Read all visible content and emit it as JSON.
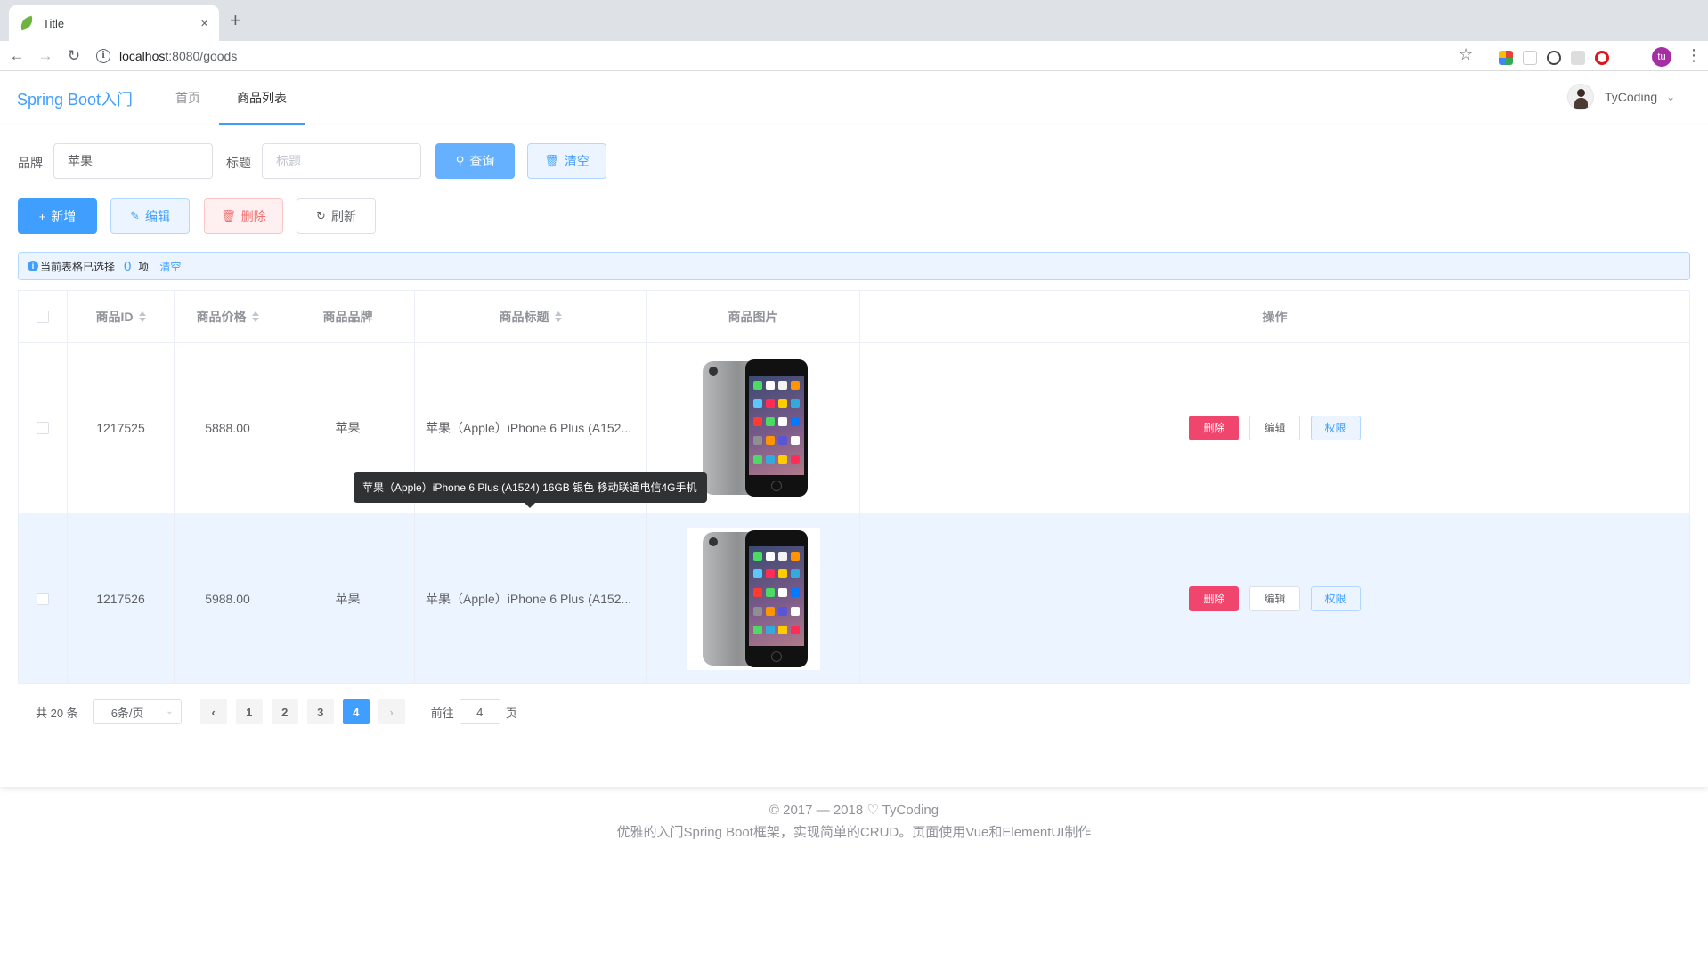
{
  "browser": {
    "tab_title": "Title",
    "tab_close": "×",
    "new_tab": "+",
    "url_host": "localhost",
    "url_path": ":8080/goods",
    "avatar_initials": "tu"
  },
  "header": {
    "brand": "Spring Boot入门",
    "menu": [
      {
        "label": "首页"
      },
      {
        "label": "商品列表"
      }
    ],
    "user_name": "TyCoding"
  },
  "search": {
    "brand_label": "品牌",
    "brand_value": "苹果",
    "title_label": "标题",
    "title_placeholder": "标题",
    "query_label": "查询",
    "clear_label": "清空"
  },
  "actions": {
    "add_label": "新增",
    "edit_label": "编辑",
    "delete_label": "删除",
    "refresh_label": "刷新"
  },
  "alert": {
    "prefix": "当前表格已选择",
    "count": "0",
    "unit": "项",
    "clear": "清空"
  },
  "table": {
    "columns": [
      "商品ID",
      "商品价格",
      "商品品牌",
      "商品标题",
      "商品图片",
      "操作"
    ],
    "rows": [
      {
        "id": "1217525",
        "price": "5888.00",
        "brand": "苹果",
        "title": "苹果（Apple）iPhone 6 Plus (A152..."
      },
      {
        "id": "1217526",
        "price": "5988.00",
        "brand": "苹果",
        "title": "苹果（Apple）iPhone 6 Plus (A152..."
      }
    ],
    "row_actions": {
      "delete": "删除",
      "edit": "编辑",
      "perm": "权限"
    },
    "tooltip": "苹果（Apple）iPhone 6 Plus (A1524) 16GB 银色 移动联通电信4G手机"
  },
  "pagination": {
    "total": "共 20 条",
    "page_size": "6条/页",
    "pages": [
      "1",
      "2",
      "3",
      "4"
    ],
    "current_page": 4,
    "goto_prefix": "前往",
    "goto_value": "4",
    "goto_suffix": "页"
  },
  "footer": {
    "line1": "© 2017 — 2018 ♡ TyCoding",
    "line2": "优雅的入门Spring Boot框架，实现简单的CRUD。页面使用Vue和ElementUI制作"
  },
  "colors": {
    "primary": "#409eff",
    "danger": "#f0466e",
    "row_hover": "#ecf5ff"
  }
}
